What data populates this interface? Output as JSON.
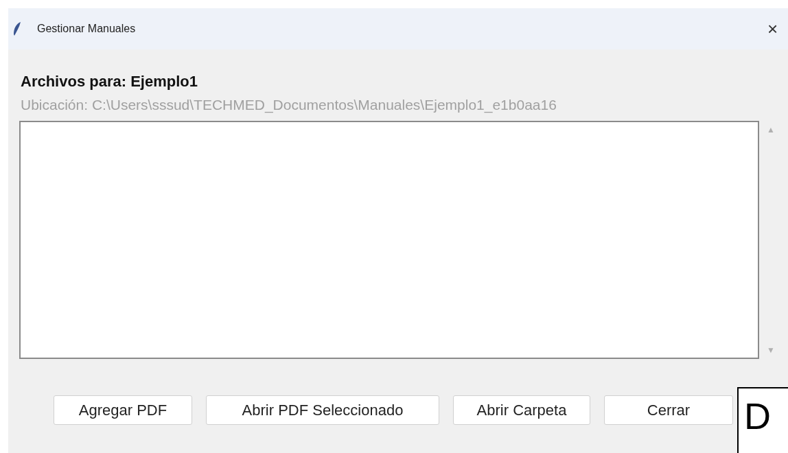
{
  "window": {
    "title": "Gestionar Manuales",
    "close": "×"
  },
  "heading": "Archivos para: Ejemplo1",
  "location": "Ubicación: C:\\Users\\sssud\\TECHMED_Documentos\\Manuales\\Ejemplo1_e1b0aa16",
  "scrollbar": {
    "up": "▲",
    "down": "▼"
  },
  "buttons": [
    "Agregar PDF",
    "Abrir PDF Seleccionado",
    "Abrir Carpeta",
    "Cerrar"
  ],
  "overlay_label": "D"
}
